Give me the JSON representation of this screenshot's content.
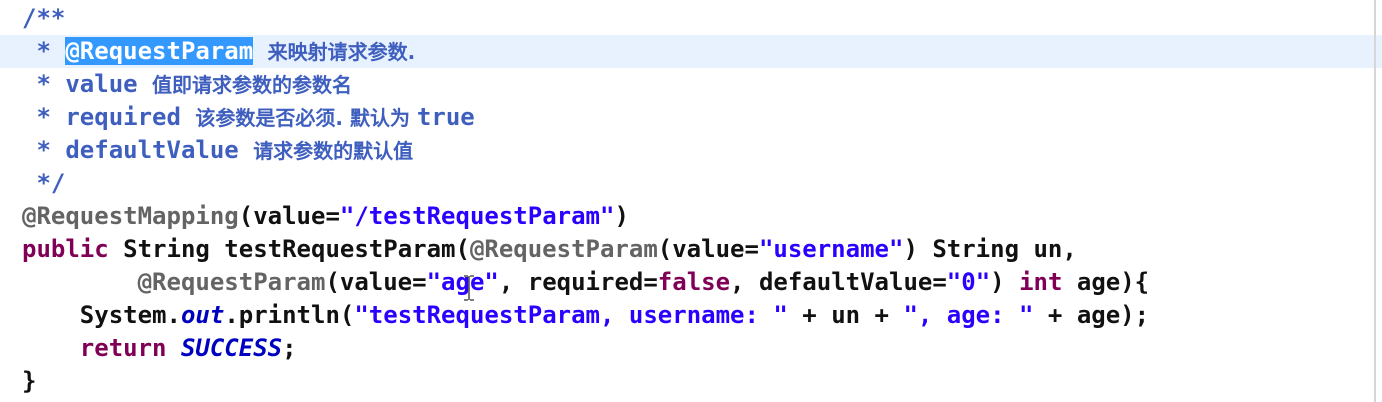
{
  "editor": {
    "language": "java",
    "selected_token": "@RequestParam",
    "lines": [
      {
        "tokens": [
          {
            "t": "/**",
            "c": "c"
          }
        ]
      },
      {
        "tokens": [
          {
            "t": " * ",
            "c": "c"
          },
          {
            "t": "@RequestParam",
            "c": "sel"
          },
          {
            "t": " ",
            "c": "c"
          },
          {
            "t": "来映射请求参数.",
            "c": "cjk"
          }
        ]
      },
      {
        "tokens": [
          {
            "t": " * value ",
            "c": "ct"
          },
          {
            "t": "值即请求参数的参数名",
            "c": "cjk"
          }
        ]
      },
      {
        "tokens": [
          {
            "t": " * required ",
            "c": "ct"
          },
          {
            "t": "该参数是否必须. 默认为 ",
            "c": "cjk"
          },
          {
            "t": "true",
            "c": "ct"
          }
        ]
      },
      {
        "tokens": [
          {
            "t": " * defaultValue ",
            "c": "ct"
          },
          {
            "t": "请求参数的默认值",
            "c": "cjk"
          }
        ]
      },
      {
        "tokens": [
          {
            "t": " */",
            "c": "c"
          }
        ]
      },
      {
        "tokens": [
          {
            "t": "@RequestMapping",
            "c": "ann"
          },
          {
            "t": "(value=",
            "c": "plain"
          },
          {
            "t": "\"/testRequestParam\"",
            "c": "str"
          },
          {
            "t": ")",
            "c": "plain"
          }
        ]
      },
      {
        "tokens": [
          {
            "t": "public",
            "c": "kw"
          },
          {
            "t": " String testRequestParam(",
            "c": "plain"
          },
          {
            "t": "@RequestParam",
            "c": "ann"
          },
          {
            "t": "(value=",
            "c": "plain"
          },
          {
            "t": "\"username\"",
            "c": "str"
          },
          {
            "t": ") String un,",
            "c": "plain"
          }
        ]
      },
      {
        "tokens": [
          {
            "t": "        ",
            "c": "plain"
          },
          {
            "t": "@RequestParam",
            "c": "ann"
          },
          {
            "t": "(value=",
            "c": "plain"
          },
          {
            "t": "\"age\"",
            "c": "str"
          },
          {
            "t": ", required=",
            "c": "plain"
          },
          {
            "t": "false",
            "c": "kw"
          },
          {
            "t": ", defaultValue=",
            "c": "plain"
          },
          {
            "t": "\"0\"",
            "c": "str"
          },
          {
            "t": ") ",
            "c": "plain"
          },
          {
            "t": "int",
            "c": "kw"
          },
          {
            "t": " age){",
            "c": "plain"
          }
        ]
      },
      {
        "tokens": [
          {
            "t": "    System.",
            "c": "plain"
          },
          {
            "t": "out",
            "c": "fld"
          },
          {
            "t": ".println(",
            "c": "plain"
          },
          {
            "t": "\"testRequestParam, username: \"",
            "c": "str"
          },
          {
            "t": " + un + ",
            "c": "plain"
          },
          {
            "t": "\", age: \"",
            "c": "str"
          },
          {
            "t": " + age);",
            "c": "plain"
          }
        ]
      },
      {
        "tokens": [
          {
            "t": "    ",
            "c": "plain"
          },
          {
            "t": "return",
            "c": "kw"
          },
          {
            "t": " ",
            "c": "plain"
          },
          {
            "t": "SUCCESS",
            "c": "fld"
          },
          {
            "t": ";",
            "c": "plain"
          }
        ]
      },
      {
        "tokens": [
          {
            "t": "}",
            "c": "plain"
          }
        ]
      }
    ]
  }
}
